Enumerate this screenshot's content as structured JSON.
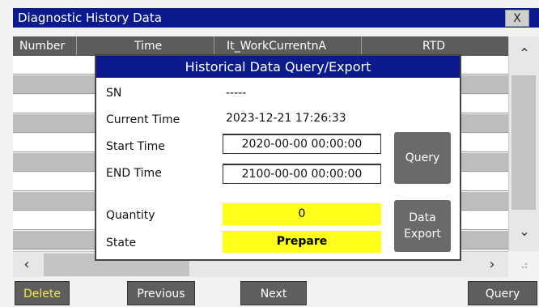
{
  "window": {
    "title": "Diagnostic History Data",
    "close_label": "X"
  },
  "table": {
    "columns": [
      "Number",
      "Time",
      "It_WorkCurrentnA",
      "RTD"
    ]
  },
  "dialog": {
    "title": "Historical Data Query/Export",
    "sn_label": "SN",
    "sn_value": "-----",
    "current_time_label": "Current Time",
    "current_time_value": "2023-12-21 17:26:33",
    "start_time_label": "Start Time",
    "start_time_value": "2020-00-00 00:00:00",
    "end_time_label": "END Time",
    "end_time_value": "2100-00-00 00:00:00",
    "quantity_label": "Quantity",
    "quantity_value": "0",
    "state_label": "State",
    "state_value": "Prepare",
    "query_button": "Query",
    "export_button_line1": "Data",
    "export_button_line2": "Export"
  },
  "scrollbars": {
    "up_icon": "chevron-up-icon",
    "down_icon": "chevron-down-icon",
    "left_icon": "chevron-left-icon",
    "right_icon": "chevron-right-icon"
  },
  "footer": {
    "delete_label": "Delete",
    "previous_label": "Previous",
    "next_label": "Next",
    "query_label": "Query"
  },
  "colors": {
    "title_bar": "#0b1b8d",
    "highlight_field": "#ffff1a",
    "delete_text": "#f2e84a",
    "header_bg": "#5c5c5c"
  }
}
